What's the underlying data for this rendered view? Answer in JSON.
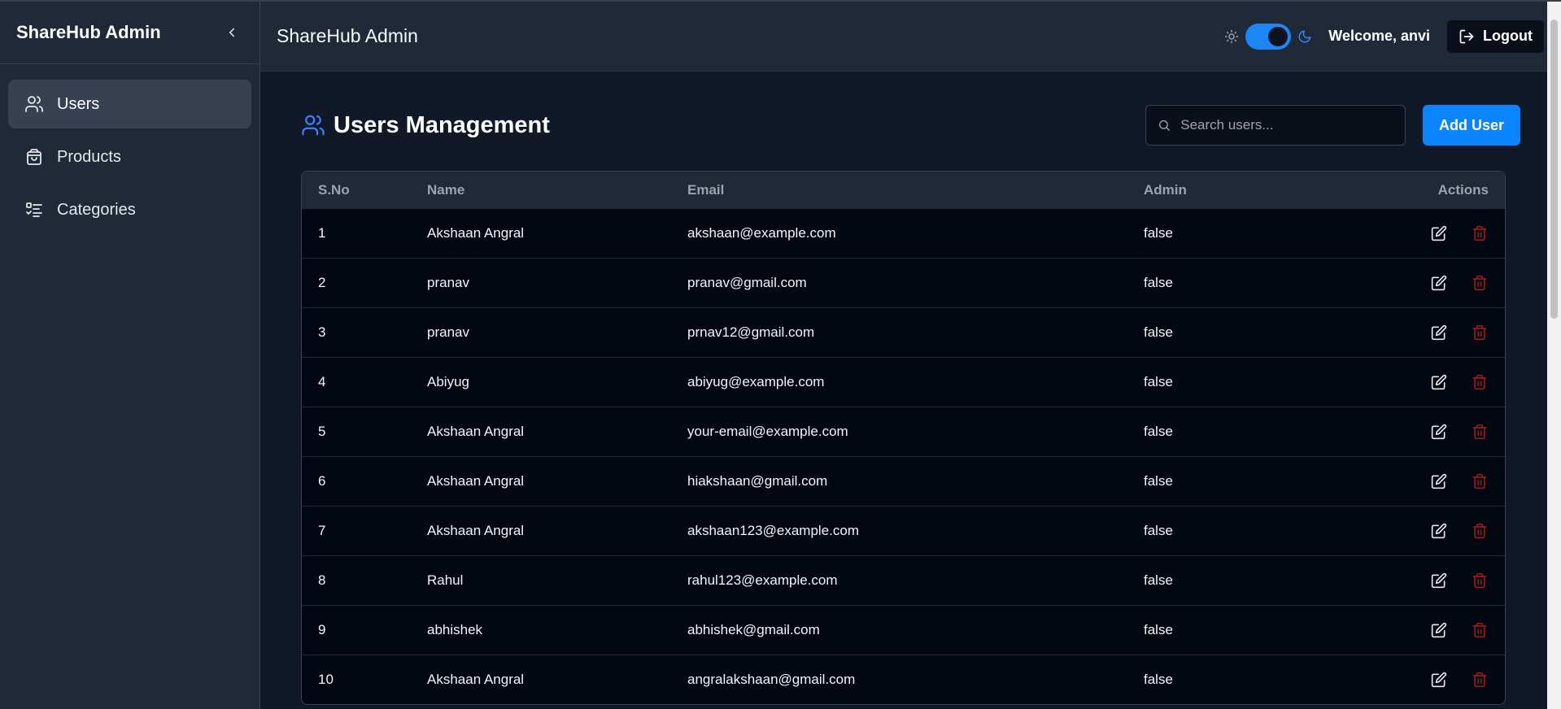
{
  "sidebar": {
    "brand": "ShareHub Admin",
    "items": [
      {
        "label": "Users",
        "icon": "users-icon",
        "active": true
      },
      {
        "label": "Products",
        "icon": "shopping-bag-icon",
        "active": false
      },
      {
        "label": "Categories",
        "icon": "list-checks-icon",
        "active": false
      }
    ]
  },
  "topbar": {
    "title": "ShareHub Admin",
    "welcome": "Welcome, anvi",
    "logout_label": "Logout"
  },
  "page": {
    "title": "Users Management",
    "search_placeholder": "Search users...",
    "add_label": "Add User"
  },
  "table": {
    "headers": [
      "S.No",
      "Name",
      "Email",
      "Admin",
      "Actions"
    ],
    "rows": [
      {
        "sno": "1",
        "name": "Akshaan Angral",
        "email": "akshaan@example.com",
        "admin": "false"
      },
      {
        "sno": "2",
        "name": "pranav",
        "email": "pranav@gmail.com",
        "admin": "false"
      },
      {
        "sno": "3",
        "name": "pranav",
        "email": "prnav12@gmail.com",
        "admin": "false"
      },
      {
        "sno": "4",
        "name": "Abiyug",
        "email": "abiyug@example.com",
        "admin": "false"
      },
      {
        "sno": "5",
        "name": "Akshaan Angral",
        "email": "your-email@example.com",
        "admin": "false"
      },
      {
        "sno": "6",
        "name": "Akshaan Angral",
        "email": "hiakshaan@gmail.com",
        "admin": "false"
      },
      {
        "sno": "7",
        "name": "Akshaan Angral",
        "email": "akshaan123@example.com",
        "admin": "false"
      },
      {
        "sno": "8",
        "name": "Rahul",
        "email": "rahul123@example.com",
        "admin": "false"
      },
      {
        "sno": "9",
        "name": "abhishek",
        "email": "abhishek@gmail.com",
        "admin": "false"
      },
      {
        "sno": "10",
        "name": "Akshaan Angral",
        "email": "angralakshaan@gmail.com",
        "admin": "false"
      }
    ]
  },
  "colors": {
    "accent": "#0b84ff",
    "delete": "#b91c1c",
    "sidebar_bg": "#1f2937",
    "page_bg": "#111827"
  }
}
